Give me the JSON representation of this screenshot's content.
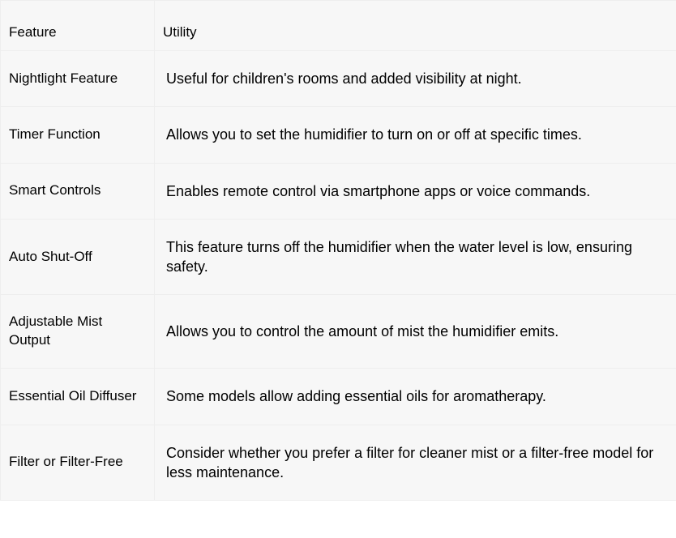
{
  "chart_data": {
    "type": "table",
    "columns": [
      "Feature",
      "Utility"
    ],
    "rows": [
      [
        "Nightlight Feature",
        "Useful for children's rooms and added visibility at night."
      ],
      [
        "Timer Function",
        "Allows you to set the humidifier to turn on or off at specific times."
      ],
      [
        "Smart Controls",
        "Enables remote control via smartphone apps or voice commands."
      ],
      [
        "Auto Shut-Off",
        "This feature turns off the humidifier when the water level is low, ensuring safety."
      ],
      [
        "Adjustable Mist Output",
        "Allows you to control the amount of mist the humidifier emits."
      ],
      [
        "Essential Oil Diffuser",
        "Some models allow adding essential oils for aromatherapy."
      ],
      [
        "Filter or Filter-Free",
        "Consider whether you prefer a filter for cleaner mist or a filter-free model for less maintenance."
      ]
    ]
  }
}
